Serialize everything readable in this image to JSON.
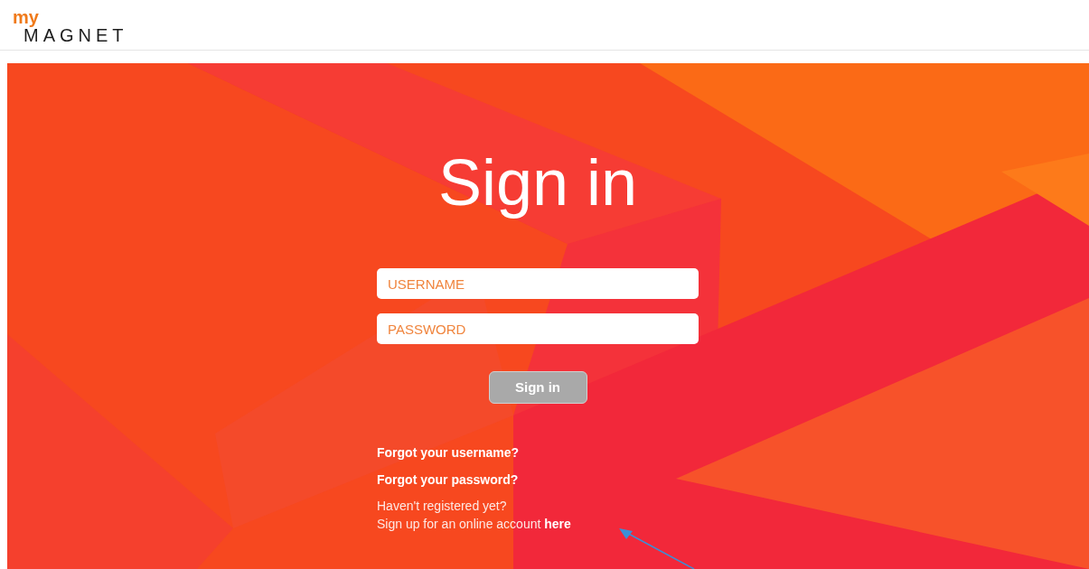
{
  "logo": {
    "prefix": "my",
    "name": "MAGNET"
  },
  "title": "Sign in",
  "fields": [
    {
      "placeholder": "USERNAME"
    },
    {
      "placeholder": "PASSWORD"
    }
  ],
  "submit": {
    "label": "Sign in",
    "disabled": true
  },
  "links": [
    "Forgot your username?",
    "Forgot your password?"
  ],
  "register": {
    "question": "Haven't registered yet?",
    "text": "Sign up for an online account",
    "link": "here"
  }
}
